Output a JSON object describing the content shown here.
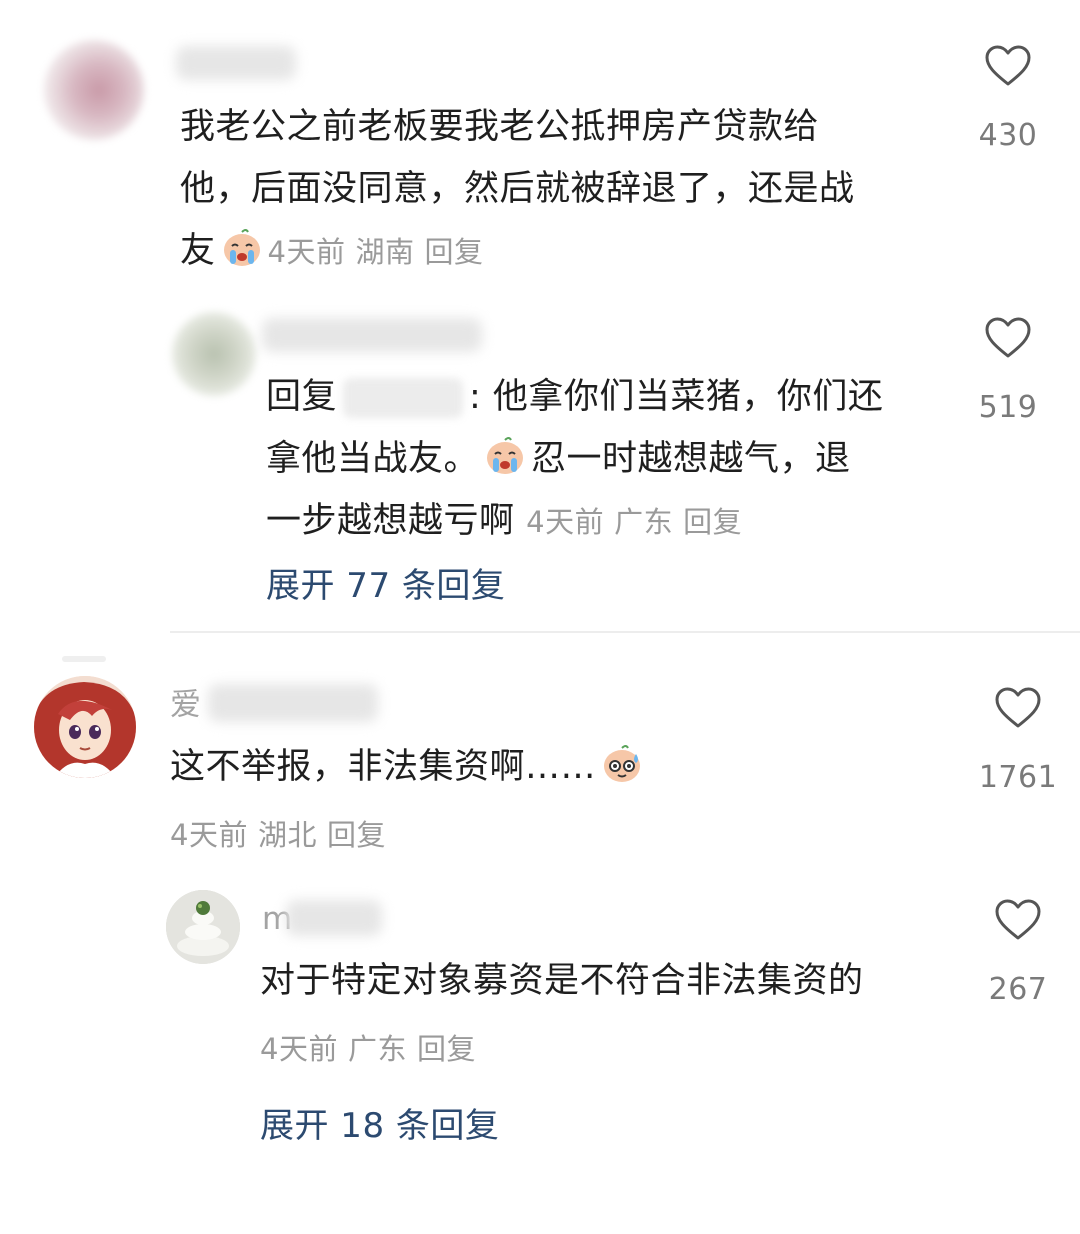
{
  "comments": [
    {
      "text_lines": [
        "我老公之前老板要我老公抵押房产贷款给",
        "他，后面没同意，然后就被辞退了，还是战",
        "友"
      ],
      "emoji": "crying-face-emoji",
      "time": "4天前",
      "location": "湖南",
      "reply_label": "回复",
      "likes": "430",
      "replies": [
        {
          "reply_prefix": "回复",
          "text_after_mention": ": 他拿你们当菜猪，你们还",
          "text_lines": [
            "拿他当战友。",
            "忍一时越想越气，退",
            "一步越想越亏啊"
          ],
          "emoji": "crying-face-emoji",
          "time": "4天前",
          "location": "广东",
          "reply_label": "回复",
          "likes": "519"
        }
      ],
      "expand_label": "展开 77 条回复"
    },
    {
      "username_visible": "爱",
      "text": "这不举报，非法集资啊……",
      "emoji": "sweating-face-emoji",
      "time": "4天前",
      "location": "湖北",
      "reply_label": "回复",
      "likes": "1761",
      "replies": [
        {
          "username_visible": "m",
          "text": "对于特定对象募资是不符合非法集资的",
          "time": "4天前",
          "location": "广东",
          "reply_label": "回复",
          "likes": "267"
        }
      ],
      "expand_label": "展开 18 条回复"
    }
  ],
  "icons": {
    "like": "heart-outline-icon"
  },
  "colors": {
    "text": "#1f1f1f",
    "meta": "#9a9a9a",
    "link": "#2c4a70",
    "icon": "#555555"
  }
}
